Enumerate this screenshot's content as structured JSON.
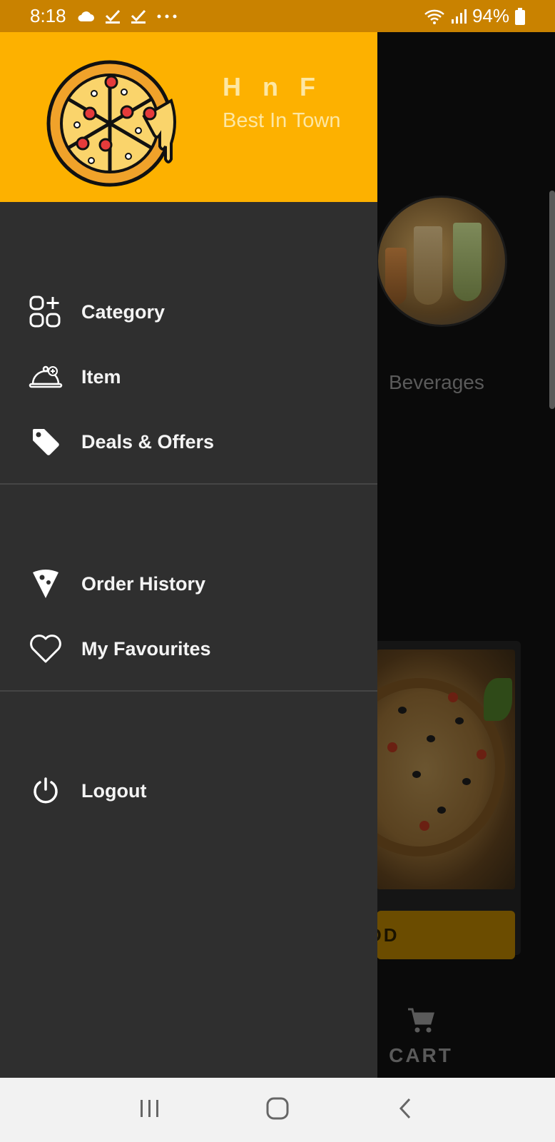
{
  "status_bar": {
    "time": "8:18",
    "battery": "94%",
    "left_icons": [
      "cloud-icon",
      "checkmark-icon",
      "checkmark-icon",
      "more-dots-icon"
    ],
    "right_icons": [
      "wifi-icon",
      "signal-icon",
      "battery-icon"
    ]
  },
  "drawer": {
    "header": {
      "app_name": "H n F",
      "tagline": "Best In Town",
      "logo_icon": "pizza-logo-icon",
      "background": "#fdb100"
    },
    "sections": [
      [
        {
          "label": "Category",
          "icon": "category-icon"
        },
        {
          "label": "Item",
          "icon": "cloche-icon"
        },
        {
          "label": "Deals & Offers",
          "icon": "tag-icon"
        }
      ],
      [
        {
          "label": "Order History",
          "icon": "pizza-slice-icon"
        },
        {
          "label": "My Favourites",
          "icon": "heart-icon"
        }
      ],
      [
        {
          "label": "Logout",
          "icon": "power-icon"
        }
      ]
    ]
  },
  "background": {
    "category_label": "Beverages",
    "add_button_fragment": "DD",
    "cart_label": "CART"
  },
  "colors": {
    "accent": "#fdb100",
    "status_bar": "#c98200",
    "drawer_bg": "#2f2f2f",
    "scrim_bg": "#0a0a0a"
  }
}
